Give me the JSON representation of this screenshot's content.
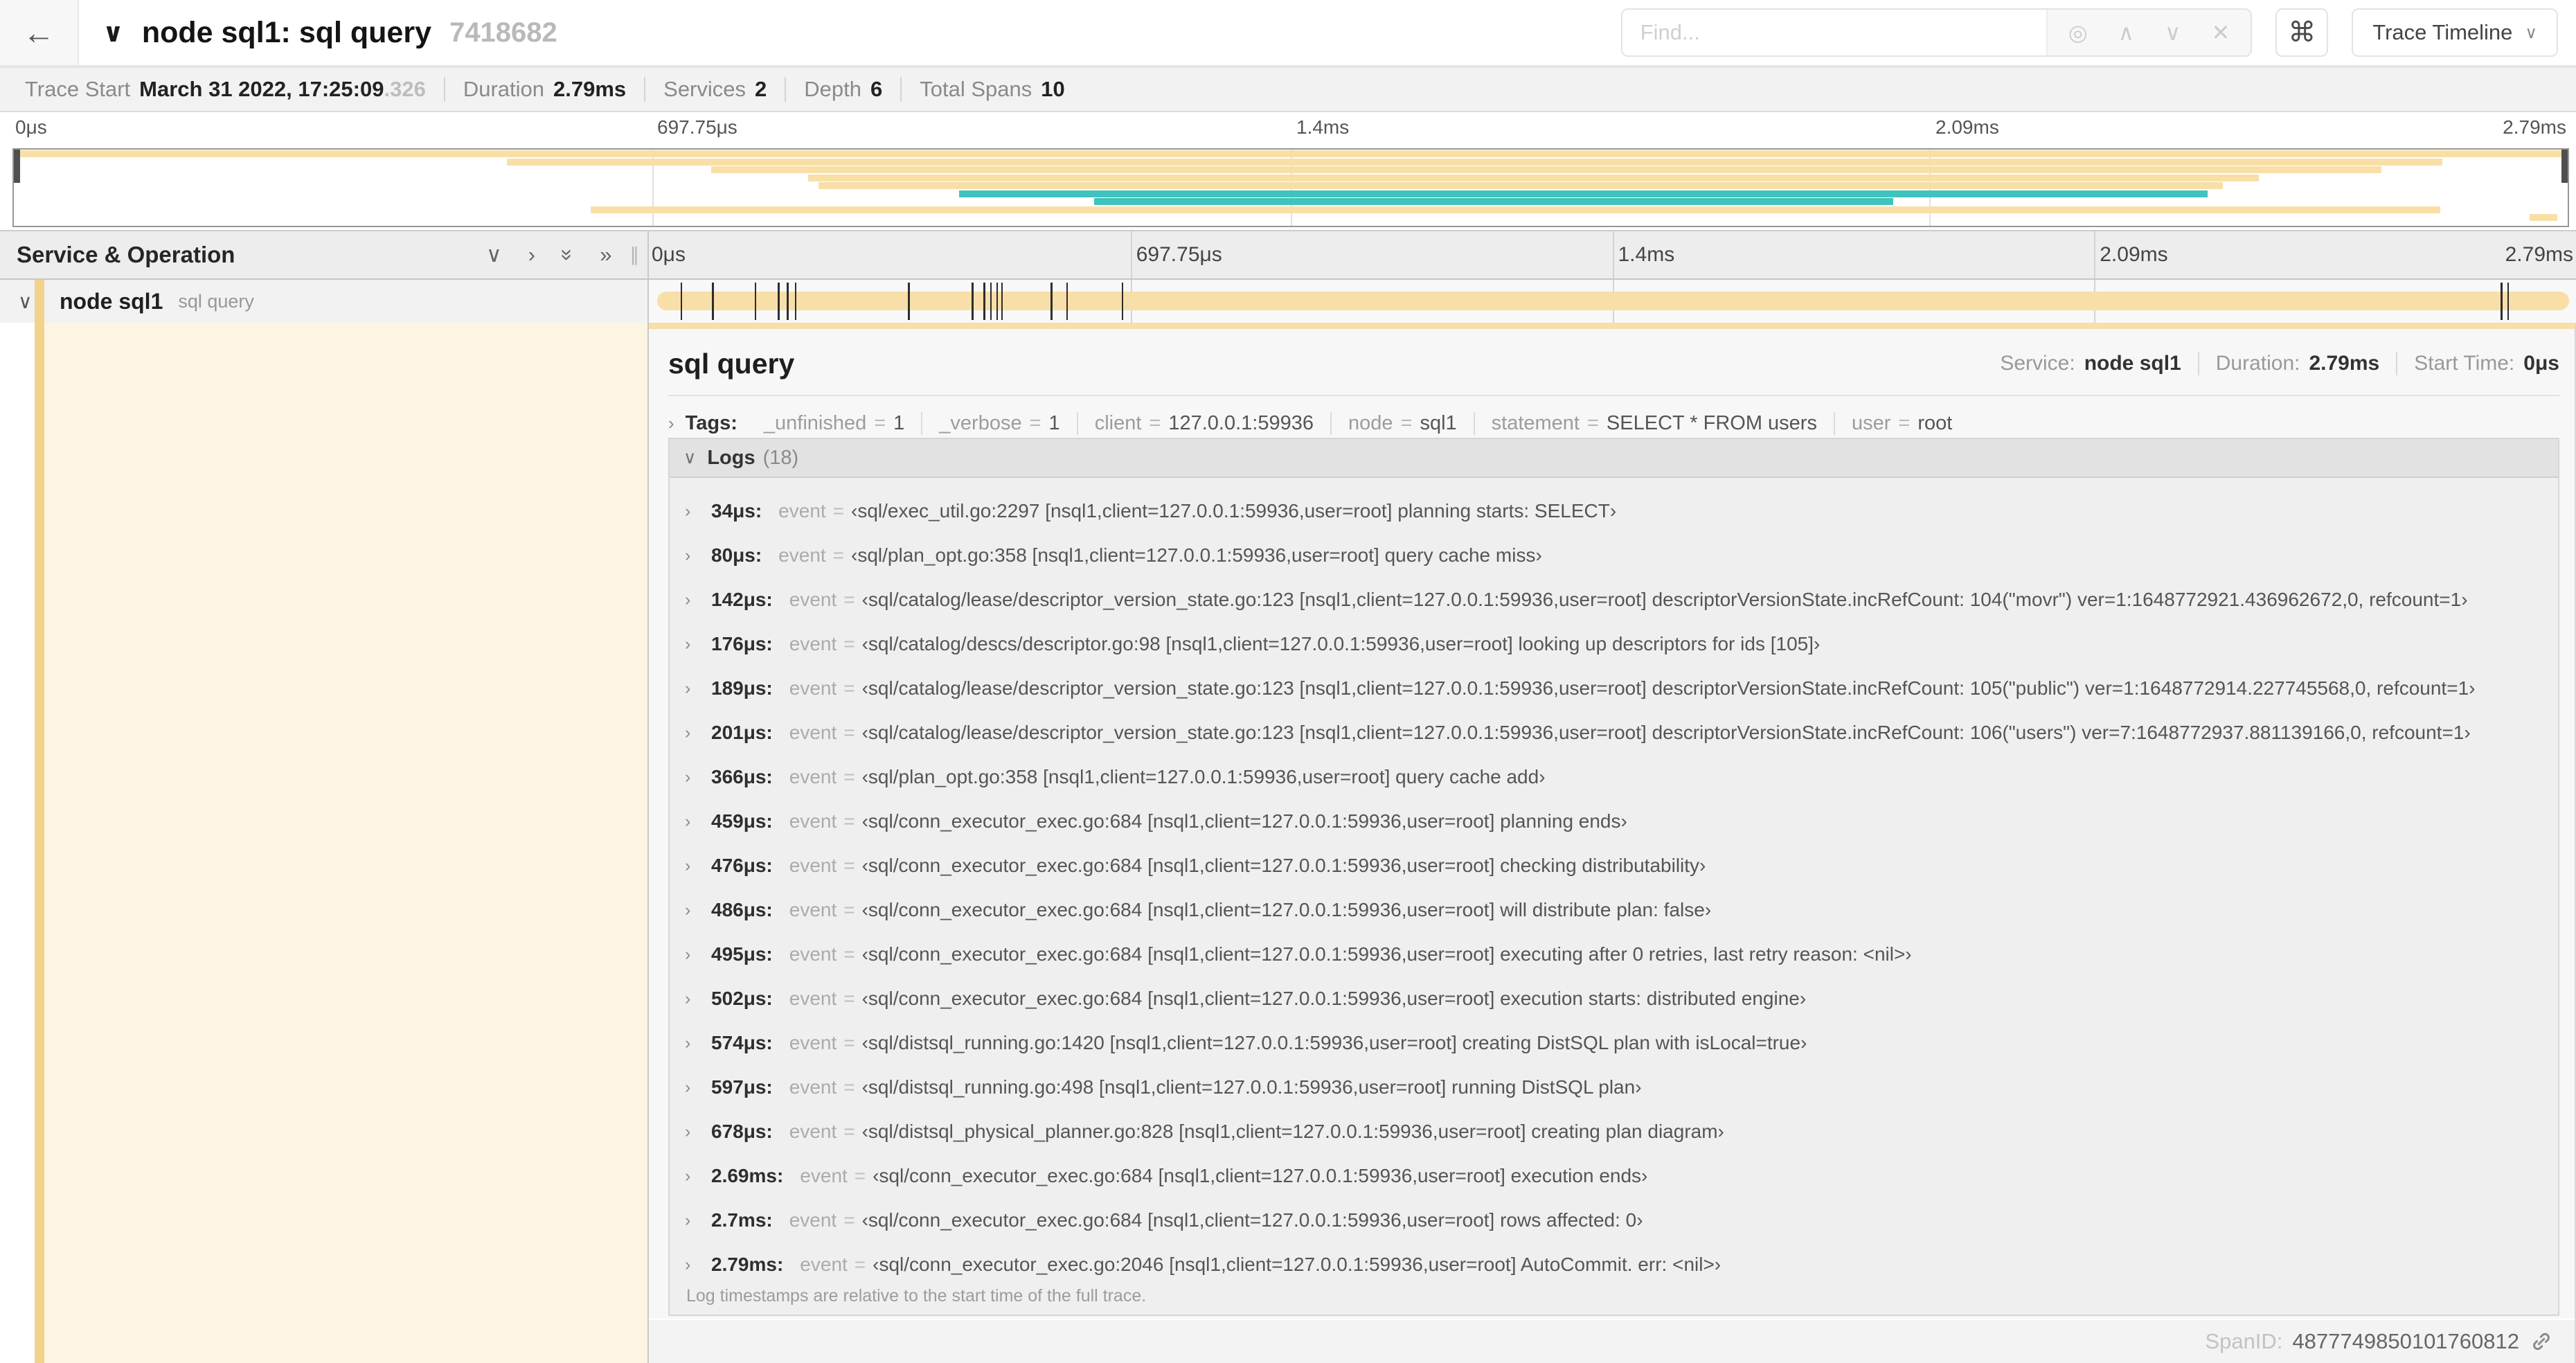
{
  "misc": {
    "eq": "="
  },
  "icons": {
    "back": "←",
    "chevron_down": "∨",
    "chevron_right": "›",
    "double_chevron_right": "»",
    "search_target": "◎",
    "arrow_up": "∧",
    "arrow_down": "∨",
    "close": "✕",
    "command": "⌘",
    "caret_down": "∨",
    "resizer": "∥"
  },
  "colors": {
    "tan": "#f8dfa8",
    "tan_strong": "#f2d38b",
    "teal": "#3ec3bd",
    "cream": "#fdf5e3"
  },
  "header": {
    "title": "node sql1: sql query",
    "trace_id": "7418682",
    "find_placeholder": "Find...",
    "view_selector": "Trace Timeline"
  },
  "summary": {
    "items": [
      {
        "label": "Trace Start",
        "value": "March 31 2022, 17:25:09",
        "suffix": ".326"
      },
      {
        "label": "Duration",
        "value": "2.79ms",
        "suffix": ""
      },
      {
        "label": "Services",
        "value": "2",
        "suffix": ""
      },
      {
        "label": "Depth",
        "value": "6",
        "suffix": ""
      },
      {
        "label": "Total Spans",
        "value": "10",
        "suffix": ""
      }
    ]
  },
  "time_ticks": [
    {
      "text": "0μs",
      "pos": 0
    },
    {
      "text": "697.75μs",
      "pos": 0.25
    },
    {
      "text": "1.4ms",
      "pos": 0.5
    },
    {
      "text": "2.09ms",
      "pos": 0.75
    },
    {
      "text": "2.79ms",
      "pos": 1
    }
  ],
  "minimap": {
    "spans": [
      {
        "start": 0,
        "end": 1,
        "color": "tan"
      },
      {
        "start": 0.193,
        "end": 0.951,
        "color": "tan"
      },
      {
        "start": 0.273,
        "end": 0.927,
        "color": "tan"
      },
      {
        "start": 0.311,
        "end": 0.879,
        "color": "tan"
      },
      {
        "start": 0.315,
        "end": 0.865,
        "color": "tan"
      },
      {
        "start": 0.37,
        "end": 0.859,
        "color": "teal"
      },
      {
        "start": 0.423,
        "end": 0.736,
        "color": "teal"
      },
      {
        "start": 0.226,
        "end": 0.95,
        "color": "tan"
      },
      {
        "start": 0.985,
        "end": 0.996,
        "color": "tan"
      }
    ]
  },
  "table": {
    "left_header": "Service & Operation"
  },
  "span_row": {
    "service": "node sql1",
    "operation": "sql query",
    "total_us": 2790,
    "log_markers_us": [
      34,
      80,
      142,
      176,
      189,
      201,
      366,
      459,
      476,
      486,
      495,
      502,
      574,
      597,
      678,
      2690,
      2700
    ]
  },
  "detail": {
    "title": "sql query",
    "meta": [
      {
        "label": "Service:",
        "value": "node sql1"
      },
      {
        "label": "Duration:",
        "value": "2.79ms"
      },
      {
        "label": "Start Time:",
        "value": "0μs"
      }
    ],
    "tags_label": "Tags:",
    "tags": [
      {
        "key": "_unfinished",
        "value": "1"
      },
      {
        "key": "_verbose",
        "value": "1"
      },
      {
        "key": "client",
        "value": "127.0.0.1:59936"
      },
      {
        "key": "node",
        "value": "sql1"
      },
      {
        "key": "statement",
        "value": "SELECT * FROM users"
      },
      {
        "key": "user",
        "value": "root"
      }
    ],
    "logs_label": "Logs",
    "logs_count": "(18)",
    "logs": [
      {
        "time": "34μs:",
        "key": "event",
        "value": "‹sql/exec_util.go:2297 [nsql1,client=127.0.0.1:59936,user=root] planning starts: SELECT›"
      },
      {
        "time": "80μs:",
        "key": "event",
        "value": "‹sql/plan_opt.go:358 [nsql1,client=127.0.0.1:59936,user=root] query cache miss›"
      },
      {
        "time": "142μs:",
        "key": "event",
        "value": "‹sql/catalog/lease/descriptor_version_state.go:123 [nsql1,client=127.0.0.1:59936,user=root] descriptorVersionState.incRefCount: 104(\"movr\") ver=1:1648772921.436962672,0, refcount=1›"
      },
      {
        "time": "176μs:",
        "key": "event",
        "value": "‹sql/catalog/descs/descriptor.go:98 [nsql1,client=127.0.0.1:59936,user=root] looking up descriptors for ids [105]›"
      },
      {
        "time": "189μs:",
        "key": "event",
        "value": "‹sql/catalog/lease/descriptor_version_state.go:123 [nsql1,client=127.0.0.1:59936,user=root] descriptorVersionState.incRefCount: 105(\"public\") ver=1:1648772914.227745568,0, refcount=1›"
      },
      {
        "time": "201μs:",
        "key": "event",
        "value": "‹sql/catalog/lease/descriptor_version_state.go:123 [nsql1,client=127.0.0.1:59936,user=root] descriptorVersionState.incRefCount: 106(\"users\") ver=7:1648772937.881139166,0, refcount=1›"
      },
      {
        "time": "366μs:",
        "key": "event",
        "value": "‹sql/plan_opt.go:358 [nsql1,client=127.0.0.1:59936,user=root] query cache add›"
      },
      {
        "time": "459μs:",
        "key": "event",
        "value": "‹sql/conn_executor_exec.go:684 [nsql1,client=127.0.0.1:59936,user=root] planning ends›"
      },
      {
        "time": "476μs:",
        "key": "event",
        "value": "‹sql/conn_executor_exec.go:684 [nsql1,client=127.0.0.1:59936,user=root] checking distributability›"
      },
      {
        "time": "486μs:",
        "key": "event",
        "value": "‹sql/conn_executor_exec.go:684 [nsql1,client=127.0.0.1:59936,user=root] will distribute plan: false›"
      },
      {
        "time": "495μs:",
        "key": "event",
        "value": "‹sql/conn_executor_exec.go:684 [nsql1,client=127.0.0.1:59936,user=root] executing after 0 retries, last retry reason: <nil>›"
      },
      {
        "time": "502μs:",
        "key": "event",
        "value": "‹sql/conn_executor_exec.go:684 [nsql1,client=127.0.0.1:59936,user=root] execution starts: distributed engine›"
      },
      {
        "time": "574μs:",
        "key": "event",
        "value": "‹sql/distsql_running.go:1420 [nsql1,client=127.0.0.1:59936,user=root] creating DistSQL plan with isLocal=true›"
      },
      {
        "time": "597μs:",
        "key": "event",
        "value": "‹sql/distsql_running.go:498 [nsql1,client=127.0.0.1:59936,user=root] running DistSQL plan›"
      },
      {
        "time": "678μs:",
        "key": "event",
        "value": "‹sql/distsql_physical_planner.go:828 [nsql1,client=127.0.0.1:59936,user=root] creating plan diagram›"
      },
      {
        "time": "2.69ms:",
        "key": "event",
        "value": "‹sql/conn_executor_exec.go:684 [nsql1,client=127.0.0.1:59936,user=root] execution ends›"
      },
      {
        "time": "2.7ms:",
        "key": "event",
        "value": "‹sql/conn_executor_exec.go:684 [nsql1,client=127.0.0.1:59936,user=root] rows affected: 0›"
      },
      {
        "time": "2.79ms:",
        "key": "event",
        "value": "‹sql/conn_executor_exec.go:2046 [nsql1,client=127.0.0.1:59936,user=root] AutoCommit. err: <nil>›"
      }
    ],
    "logs_footnote": "Log timestamps are relative to the start time of the full trace.",
    "span_id_label": "SpanID:",
    "span_id": "4877749850101760812"
  }
}
